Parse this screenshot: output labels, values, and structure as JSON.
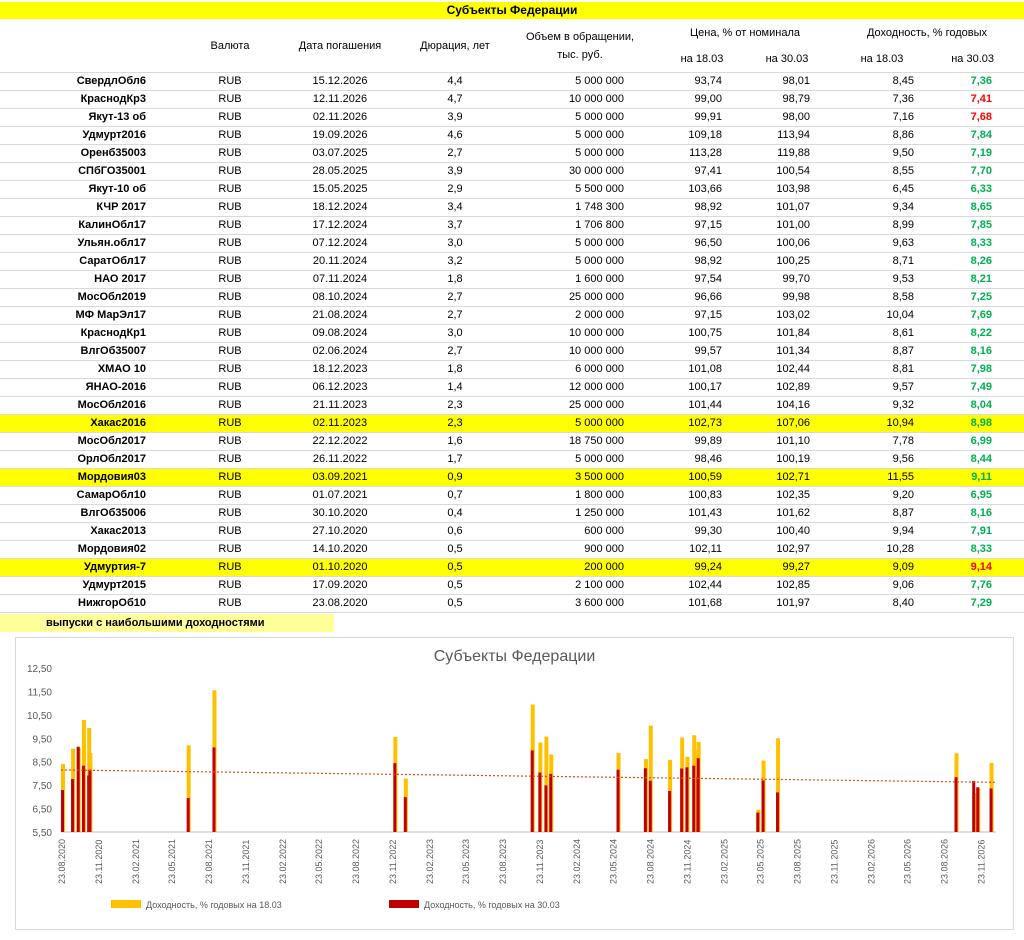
{
  "header": {
    "title": "Субъекты Федерации",
    "col_currency": "Валюта",
    "col_maturity": "Дата погашения",
    "col_duration": "Дюрация, лет",
    "col_volume_line1": "Объем в обращении,",
    "col_volume_line2": "тыс. руб.",
    "col_price": "Цена, % от номинала",
    "col_yield": "Доходность, % годовых",
    "date1": "на 18.03",
    "date2": "на 30.03"
  },
  "colors": {
    "highlight": "#ffff00",
    "green": "#00b050",
    "red": "#ff0000",
    "bar1": "#ffc000",
    "bar2": "#c00000",
    "trend": "#e04a1a"
  },
  "rows": [
    {
      "name": "СвердлОбл6",
      "cur": "RUB",
      "date": "15.12.2026",
      "dur": "4,4",
      "vol": "5 000 000",
      "p1": "93,74",
      "p2": "98,01",
      "y1": "8,45",
      "y2": "7,36",
      "c": "green",
      "hl": false
    },
    {
      "name": "КраснодКр3",
      "cur": "RUB",
      "date": "12.11.2026",
      "dur": "4,7",
      "vol": "10 000 000",
      "p1": "99,00",
      "p2": "98,79",
      "y1": "7,36",
      "y2": "7,41",
      "c": "red",
      "hl": false
    },
    {
      "name": "Якут-13 об",
      "cur": "RUB",
      "date": "02.11.2026",
      "dur": "3,9",
      "vol": "5 000 000",
      "p1": "99,91",
      "p2": "98,00",
      "y1": "7,16",
      "y2": "7,68",
      "c": "red",
      "hl": false
    },
    {
      "name": "Удмурт2016",
      "cur": "RUB",
      "date": "19.09.2026",
      "dur": "4,6",
      "vol": "5 000 000",
      "p1": "109,18",
      "p2": "113,94",
      "y1": "8,86",
      "y2": "7,84",
      "c": "green",
      "hl": false
    },
    {
      "name": "Оренб35003",
      "cur": "RUB",
      "date": "03.07.2025",
      "dur": "2,7",
      "vol": "5 000 000",
      "p1": "113,28",
      "p2": "119,88",
      "y1": "9,50",
      "y2": "7,19",
      "c": "green",
      "hl": false
    },
    {
      "name": "СПбГО35001",
      "cur": "RUB",
      "date": "28.05.2025",
      "dur": "3,9",
      "vol": "30 000 000",
      "p1": "97,41",
      "p2": "100,54",
      "y1": "8,55",
      "y2": "7,70",
      "c": "green",
      "hl": false
    },
    {
      "name": "Якут-10 об",
      "cur": "RUB",
      "date": "15.05.2025",
      "dur": "2,9",
      "vol": "5 500 000",
      "p1": "103,66",
      "p2": "103,98",
      "y1": "6,45",
      "y2": "6,33",
      "c": "green",
      "hl": false
    },
    {
      "name": "КЧР 2017",
      "cur": "RUB",
      "date": "18.12.2024",
      "dur": "3,4",
      "vol": "1 748 300",
      "p1": "98,92",
      "p2": "101,07",
      "y1": "9,34",
      "y2": "8,65",
      "c": "green",
      "hl": false
    },
    {
      "name": "КалинОбл17",
      "cur": "RUB",
      "date": "17.12.2024",
      "dur": "3,7",
      "vol": "1 706 800",
      "p1": "97,15",
      "p2": "101,00",
      "y1": "8,99",
      "y2": "7,85",
      "c": "green",
      "hl": false
    },
    {
      "name": "Ульян.обл17",
      "cur": "RUB",
      "date": "07.12.2024",
      "dur": "3,0",
      "vol": "5 000 000",
      "p1": "96,50",
      "p2": "100,06",
      "y1": "9,63",
      "y2": "8,33",
      "c": "green",
      "hl": false
    },
    {
      "name": "СаратОбл17",
      "cur": "RUB",
      "date": "20.11.2024",
      "dur": "3,2",
      "vol": "5 000 000",
      "p1": "98,92",
      "p2": "100,25",
      "y1": "8,71",
      "y2": "8,26",
      "c": "green",
      "hl": false
    },
    {
      "name": "НАО 2017",
      "cur": "RUB",
      "date": "07.11.2024",
      "dur": "1,8",
      "vol": "1 600 000",
      "p1": "97,54",
      "p2": "99,70",
      "y1": "9,53",
      "y2": "8,21",
      "c": "green",
      "hl": false
    },
    {
      "name": "МосОбл2019",
      "cur": "RUB",
      "date": "08.10.2024",
      "dur": "2,7",
      "vol": "25 000 000",
      "p1": "96,66",
      "p2": "99,98",
      "y1": "8,58",
      "y2": "7,25",
      "c": "green",
      "hl": false
    },
    {
      "name": "МФ МарЭл17",
      "cur": "RUB",
      "date": "21.08.2024",
      "dur": "2,7",
      "vol": "2 000 000",
      "p1": "97,15",
      "p2": "103,02",
      "y1": "10,04",
      "y2": "7,69",
      "c": "green",
      "hl": false
    },
    {
      "name": "КраснодКр1",
      "cur": "RUB",
      "date": "09.08.2024",
      "dur": "3,0",
      "vol": "10 000 000",
      "p1": "100,75",
      "p2": "101,84",
      "y1": "8,61",
      "y2": "8,22",
      "c": "green",
      "hl": false
    },
    {
      "name": "ВлгОб35007",
      "cur": "RUB",
      "date": "02.06.2024",
      "dur": "2,7",
      "vol": "10 000 000",
      "p1": "99,57",
      "p2": "101,34",
      "y1": "8,87",
      "y2": "8,16",
      "c": "green",
      "hl": false
    },
    {
      "name": "ХМАО 10",
      "cur": "RUB",
      "date": "18.12.2023",
      "dur": "1,8",
      "vol": "6 000 000",
      "p1": "101,08",
      "p2": "102,44",
      "y1": "8,81",
      "y2": "7,98",
      "c": "green",
      "hl": false
    },
    {
      "name": "ЯНАО-2016",
      "cur": "RUB",
      "date": "06.12.2023",
      "dur": "1,4",
      "vol": "12 000 000",
      "p1": "100,17",
      "p2": "102,89",
      "y1": "9,57",
      "y2": "7,49",
      "c": "green",
      "hl": false
    },
    {
      "name": "МосОбл2016",
      "cur": "RUB",
      "date": "21.11.2023",
      "dur": "2,3",
      "vol": "25 000 000",
      "p1": "101,44",
      "p2": "104,16",
      "y1": "9,32",
      "y2": "8,04",
      "c": "green",
      "hl": false
    },
    {
      "name": "Хакас2016",
      "cur": "RUB",
      "date": "02.11.2023",
      "dur": "2,3",
      "vol": "5 000 000",
      "p1": "102,73",
      "p2": "107,06",
      "y1": "10,94",
      "y2": "8,98",
      "c": "green",
      "hl": true
    },
    {
      "name": "МосОбл2017",
      "cur": "RUB",
      "date": "22.12.2022",
      "dur": "1,6",
      "vol": "18 750 000",
      "p1": "99,89",
      "p2": "101,10",
      "y1": "7,78",
      "y2": "6,99",
      "c": "green",
      "hl": false
    },
    {
      "name": "ОрлОбл2017",
      "cur": "RUB",
      "date": "26.11.2022",
      "dur": "1,7",
      "vol": "5 000 000",
      "p1": "98,46",
      "p2": "100,19",
      "y1": "9,56",
      "y2": "8,44",
      "c": "green",
      "hl": false
    },
    {
      "name": "Мордовия03",
      "cur": "RUB",
      "date": "03.09.2021",
      "dur": "0,9",
      "vol": "3 500 000",
      "p1": "100,59",
      "p2": "102,71",
      "y1": "11,55",
      "y2": "9,11",
      "c": "green",
      "hl": true
    },
    {
      "name": "СамарОбл10",
      "cur": "RUB",
      "date": "01.07.2021",
      "dur": "0,7",
      "vol": "1 800 000",
      "p1": "100,83",
      "p2": "102,35",
      "y1": "9,20",
      "y2": "6,95",
      "c": "green",
      "hl": false
    },
    {
      "name": "ВлгОб35006",
      "cur": "RUB",
      "date": "30.10.2020",
      "dur": "0,4",
      "vol": "1 250 000",
      "p1": "101,43",
      "p2": "101,62",
      "y1": "8,87",
      "y2": "8,16",
      "c": "green",
      "hl": false
    },
    {
      "name": "Хакас2013",
      "cur": "RUB",
      "date": "27.10.2020",
      "dur": "0,6",
      "vol": "600 000",
      "p1": "99,30",
      "p2": "100,40",
      "y1": "9,94",
      "y2": "7,91",
      "c": "green",
      "hl": false
    },
    {
      "name": "Мордовия02",
      "cur": "RUB",
      "date": "14.10.2020",
      "dur": "0,5",
      "vol": "900 000",
      "p1": "102,11",
      "p2": "102,97",
      "y1": "10,28",
      "y2": "8,33",
      "c": "green",
      "hl": false
    },
    {
      "name": "Удмуртия-7",
      "cur": "RUB",
      "date": "01.10.2020",
      "dur": "0,5",
      "vol": "200 000",
      "p1": "99,24",
      "p2": "99,27",
      "y1": "9,09",
      "y2": "9,14",
      "c": "red",
      "hl": true
    },
    {
      "name": "Удмурт2015",
      "cur": "RUB",
      "date": "17.09.2020",
      "dur": "0,5",
      "vol": "2 100 000",
      "p1": "102,44",
      "p2": "102,85",
      "y1": "9,06",
      "y2": "7,76",
      "c": "green",
      "hl": false
    },
    {
      "name": "НижгорОб10",
      "cur": "RUB",
      "date": "23.08.2020",
      "dur": "0,5",
      "vol": "3 600 000",
      "p1": "101,68",
      "p2": "101,97",
      "y1": "8,40",
      "y2": "7,29",
      "c": "green",
      "hl": false
    }
  ],
  "note": "выпуски с наибольшими доходностями",
  "chart_data": {
    "type": "bar",
    "title": "Субъекты Федерации",
    "ylim": [
      5.5,
      12.5
    ],
    "yticks": [
      "12,50",
      "11,50",
      "10,50",
      "9,50",
      "8,50",
      "7,50",
      "6,50",
      "5,50"
    ],
    "xlabels": [
      "23.08.2020",
      "23.11.2020",
      "23.02.2021",
      "23.05.2021",
      "23.08.2021",
      "23.11.2021",
      "23.02.2022",
      "23.05.2022",
      "23.08.2022",
      "23.11.2022",
      "23.02.2023",
      "23.05.2023",
      "23.08.2023",
      "23.11.2023",
      "23.02.2024",
      "23.05.2024",
      "23.08.2024",
      "23.11.2024",
      "23.02.2025",
      "23.05.2025",
      "23.08.2025",
      "23.11.2025",
      "23.02.2026",
      "23.05.2026",
      "23.08.2026",
      "23.11.2026"
    ],
    "series": [
      {
        "name": "Доходность, % годовых на 18.03"
      },
      {
        "name": "Доходность, % годовых на 30.03"
      }
    ],
    "points": [
      {
        "d": "2020-08-23",
        "a": 8.4,
        "b": 7.29
      },
      {
        "d": "2020-09-17",
        "a": 9.06,
        "b": 7.76
      },
      {
        "d": "2020-10-01",
        "a": 9.09,
        "b": 9.14
      },
      {
        "d": "2020-10-14",
        "a": 10.28,
        "b": 8.33
      },
      {
        "d": "2020-10-27",
        "a": 9.94,
        "b": 7.91
      },
      {
        "d": "2020-10-30",
        "a": 8.87,
        "b": 8.16
      },
      {
        "d": "2021-07-01",
        "a": 9.2,
        "b": 6.95
      },
      {
        "d": "2021-09-03",
        "a": 11.55,
        "b": 9.11
      },
      {
        "d": "2022-11-26",
        "a": 9.56,
        "b": 8.44
      },
      {
        "d": "2022-12-22",
        "a": 7.78,
        "b": 6.99
      },
      {
        "d": "2023-11-02",
        "a": 10.94,
        "b": 8.98
      },
      {
        "d": "2023-11-21",
        "a": 9.32,
        "b": 8.04
      },
      {
        "d": "2023-12-06",
        "a": 9.57,
        "b": 7.49
      },
      {
        "d": "2023-12-18",
        "a": 8.81,
        "b": 7.98
      },
      {
        "d": "2024-06-02",
        "a": 8.87,
        "b": 8.16
      },
      {
        "d": "2024-08-09",
        "a": 8.61,
        "b": 8.22
      },
      {
        "d": "2024-08-21",
        "a": 10.04,
        "b": 7.69
      },
      {
        "d": "2024-10-08",
        "a": 8.58,
        "b": 7.25
      },
      {
        "d": "2024-11-07",
        "a": 9.53,
        "b": 8.21
      },
      {
        "d": "2024-11-20",
        "a": 8.71,
        "b": 8.26
      },
      {
        "d": "2024-12-07",
        "a": 9.63,
        "b": 8.33
      },
      {
        "d": "2024-12-17",
        "a": 8.99,
        "b": 7.85
      },
      {
        "d": "2024-12-18",
        "a": 9.34,
        "b": 8.65
      },
      {
        "d": "2025-05-15",
        "a": 6.45,
        "b": 6.33
      },
      {
        "d": "2025-05-28",
        "a": 8.55,
        "b": 7.7
      },
      {
        "d": "2025-07-03",
        "a": 9.5,
        "b": 7.19
      },
      {
        "d": "2026-09-19",
        "a": 8.86,
        "b": 7.84
      },
      {
        "d": "2026-11-02",
        "a": 7.16,
        "b": 7.68
      },
      {
        "d": "2026-11-12",
        "a": 7.36,
        "b": 7.41
      },
      {
        "d": "2026-12-15",
        "a": 8.45,
        "b": 7.36
      }
    ],
    "trend": {
      "start": 8.15,
      "end": 7.62
    }
  }
}
